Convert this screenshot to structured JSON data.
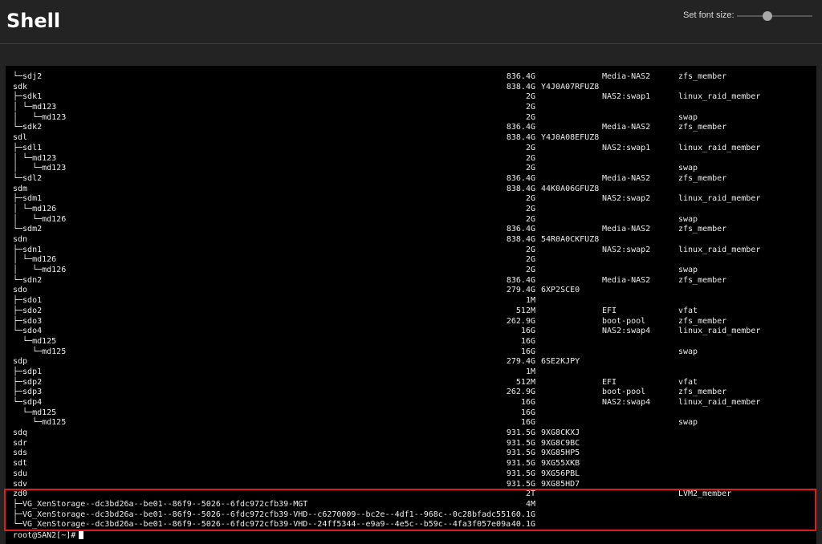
{
  "header": {
    "title": "Shell",
    "font_size_label": "Set font size:",
    "font_size_slider_fraction": 0.4
  },
  "terminal": {
    "lines": [
      {
        "name": "└─sdj2",
        "size": "836.4G",
        "serial": "",
        "label": "Media-NAS2",
        "fstype": "zfs_member"
      },
      {
        "name": "sdk",
        "size": "838.4G",
        "serial": "Y4J0A07RFUZ8",
        "label": "",
        "fstype": ""
      },
      {
        "name": "├─sdk1",
        "size": "2G",
        "serial": "",
        "label": "NAS2:swap1",
        "fstype": "linux_raid_member"
      },
      {
        "name": "│ └─md123",
        "size": "2G",
        "serial": "",
        "label": "",
        "fstype": ""
      },
      {
        "name": "│   └─md123",
        "size": "2G",
        "serial": "",
        "label": "",
        "fstype": "swap"
      },
      {
        "name": "└─sdk2",
        "size": "836.4G",
        "serial": "",
        "label": "Media-NAS2",
        "fstype": "zfs_member"
      },
      {
        "name": "sdl",
        "size": "838.4G",
        "serial": "Y4J0A08EFUZ8",
        "label": "",
        "fstype": ""
      },
      {
        "name": "├─sdl1",
        "size": "2G",
        "serial": "",
        "label": "NAS2:swap1",
        "fstype": "linux_raid_member"
      },
      {
        "name": "│ └─md123",
        "size": "2G",
        "serial": "",
        "label": "",
        "fstype": ""
      },
      {
        "name": "│   └─md123",
        "size": "2G",
        "serial": "",
        "label": "",
        "fstype": "swap"
      },
      {
        "name": "└─sdl2",
        "size": "836.4G",
        "serial": "",
        "label": "Media-NAS2",
        "fstype": "zfs_member"
      },
      {
        "name": "sdm",
        "size": "838.4G",
        "serial": "44K0A06GFUZ8",
        "label": "",
        "fstype": ""
      },
      {
        "name": "├─sdm1",
        "size": "2G",
        "serial": "",
        "label": "NAS2:swap2",
        "fstype": "linux_raid_member"
      },
      {
        "name": "│ └─md126",
        "size": "2G",
        "serial": "",
        "label": "",
        "fstype": ""
      },
      {
        "name": "│   └─md126",
        "size": "2G",
        "serial": "",
        "label": "",
        "fstype": "swap"
      },
      {
        "name": "└─sdm2",
        "size": "836.4G",
        "serial": "",
        "label": "Media-NAS2",
        "fstype": "zfs_member"
      },
      {
        "name": "sdn",
        "size": "838.4G",
        "serial": "54R0A0CKFUZ8",
        "label": "",
        "fstype": ""
      },
      {
        "name": "├─sdn1",
        "size": "2G",
        "serial": "",
        "label": "NAS2:swap2",
        "fstype": "linux_raid_member"
      },
      {
        "name": "│ └─md126",
        "size": "2G",
        "serial": "",
        "label": "",
        "fstype": ""
      },
      {
        "name": "│   └─md126",
        "size": "2G",
        "serial": "",
        "label": "",
        "fstype": "swap"
      },
      {
        "name": "└─sdn2",
        "size": "836.4G",
        "serial": "",
        "label": "Media-NAS2",
        "fstype": "zfs_member"
      },
      {
        "name": "sdo",
        "size": "279.4G",
        "serial": "6XP2SCE0",
        "label": "",
        "fstype": ""
      },
      {
        "name": "├─sdo1",
        "size": "1M",
        "serial": "",
        "label": "",
        "fstype": ""
      },
      {
        "name": "├─sdo2",
        "size": "512M",
        "serial": "",
        "label": "EFI",
        "fstype": "vfat"
      },
      {
        "name": "├─sdo3",
        "size": "262.9G",
        "serial": "",
        "label": "boot-pool",
        "fstype": "zfs_member"
      },
      {
        "name": "└─sdo4",
        "size": "16G",
        "serial": "",
        "label": "NAS2:swap4",
        "fstype": "linux_raid_member"
      },
      {
        "name": "  └─md125",
        "size": "16G",
        "serial": "",
        "label": "",
        "fstype": ""
      },
      {
        "name": "    └─md125",
        "size": "16G",
        "serial": "",
        "label": "",
        "fstype": "swap"
      },
      {
        "name": "sdp",
        "size": "279.4G",
        "serial": "6SE2KJPY",
        "label": "",
        "fstype": ""
      },
      {
        "name": "├─sdp1",
        "size": "1M",
        "serial": "",
        "label": "",
        "fstype": ""
      },
      {
        "name": "├─sdp2",
        "size": "512M",
        "serial": "",
        "label": "EFI",
        "fstype": "vfat"
      },
      {
        "name": "├─sdp3",
        "size": "262.9G",
        "serial": "",
        "label": "boot-pool",
        "fstype": "zfs_member"
      },
      {
        "name": "└─sdp4",
        "size": "16G",
        "serial": "",
        "label": "NAS2:swap4",
        "fstype": "linux_raid_member"
      },
      {
        "name": "  └─md125",
        "size": "16G",
        "serial": "",
        "label": "",
        "fstype": ""
      },
      {
        "name": "    └─md125",
        "size": "16G",
        "serial": "",
        "label": "",
        "fstype": "swap"
      },
      {
        "name": "sdq",
        "size": "931.5G",
        "serial": "9XG8CKXJ",
        "label": "",
        "fstype": ""
      },
      {
        "name": "sdr",
        "size": "931.5G",
        "serial": "9XG8C9BC",
        "label": "",
        "fstype": ""
      },
      {
        "name": "sds",
        "size": "931.5G",
        "serial": "9XG85HP5",
        "label": "",
        "fstype": ""
      },
      {
        "name": "sdt",
        "size": "931.5G",
        "serial": "9XG55XKB",
        "label": "",
        "fstype": ""
      },
      {
        "name": "sdu",
        "size": "931.5G",
        "serial": "9XG56PBL",
        "label": "",
        "fstype": ""
      },
      {
        "name": "sdv",
        "size": "931.5G",
        "serial": "9XG85HD7",
        "label": "",
        "fstype": ""
      },
      {
        "name": "zd0",
        "size": "2T",
        "serial": "",
        "label": "",
        "fstype": "LVM2_member"
      },
      {
        "name": "├─VG_XenStorage--dc3bd26a--be01--86f9--5026--6fdc972cfb39-MGT",
        "size": "4M",
        "serial": "",
        "label": "",
        "fstype": ""
      },
      {
        "name": "├─VG_XenStorage--dc3bd26a--be01--86f9--5026--6fdc972cfb39-VHD--c6270009--bc2e--4df1--968c--0c28bfadc551",
        "size": "60.1G",
        "serial": "",
        "label": "",
        "fstype": ""
      },
      {
        "name": "└─VG_XenStorage--dc3bd26a--be01--86f9--5026--6fdc972cfb39-VHD--24ff5344--e9a9--4e5c--b59c--4fa3f057e09a",
        "size": "40.1G",
        "serial": "",
        "label": "",
        "fstype": ""
      }
    ],
    "prompt": "root@SAN2[~]#"
  },
  "colors": {
    "page_bg": "#232323",
    "terminal_bg": "#000000",
    "terminal_text": "#ececec",
    "highlight": "#e01b1b"
  }
}
